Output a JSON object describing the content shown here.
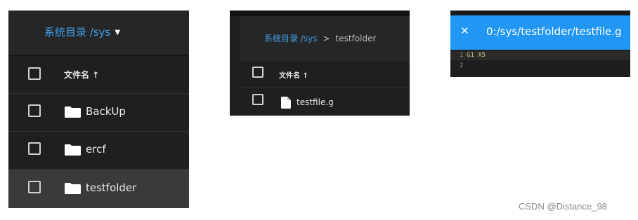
{
  "colors": {
    "accent": "#3f9fe9",
    "titlebar": "#2196f3",
    "panel_bg": "#1f1f1f"
  },
  "panel1": {
    "breadcrumb": "系统目录 /sys",
    "caret_icon": "caret-down-icon",
    "column_header": "文件名 ↑",
    "rows": [
      {
        "name": "BackUp",
        "icon": "folder-icon"
      },
      {
        "name": "ercf",
        "icon": "folder-icon"
      },
      {
        "name": "testfolder",
        "icon": "folder-icon",
        "selected": true
      }
    ]
  },
  "panel2": {
    "breadcrumb_root": "系统目录 /sys",
    "breadcrumb_sep": ">",
    "breadcrumb_current": "testfolder",
    "column_header": "文件名 ↑",
    "rows": [
      {
        "name": "testfile.g",
        "icon": "file-icon"
      }
    ]
  },
  "panel3": {
    "close_label": "✕",
    "title": "0:/sys/testfolder/testfile.g",
    "lines": [
      {
        "num": "1",
        "text": "G1 X5"
      },
      {
        "num": "2",
        "text": ""
      }
    ]
  },
  "watermark": "CSDN @Distance_98"
}
